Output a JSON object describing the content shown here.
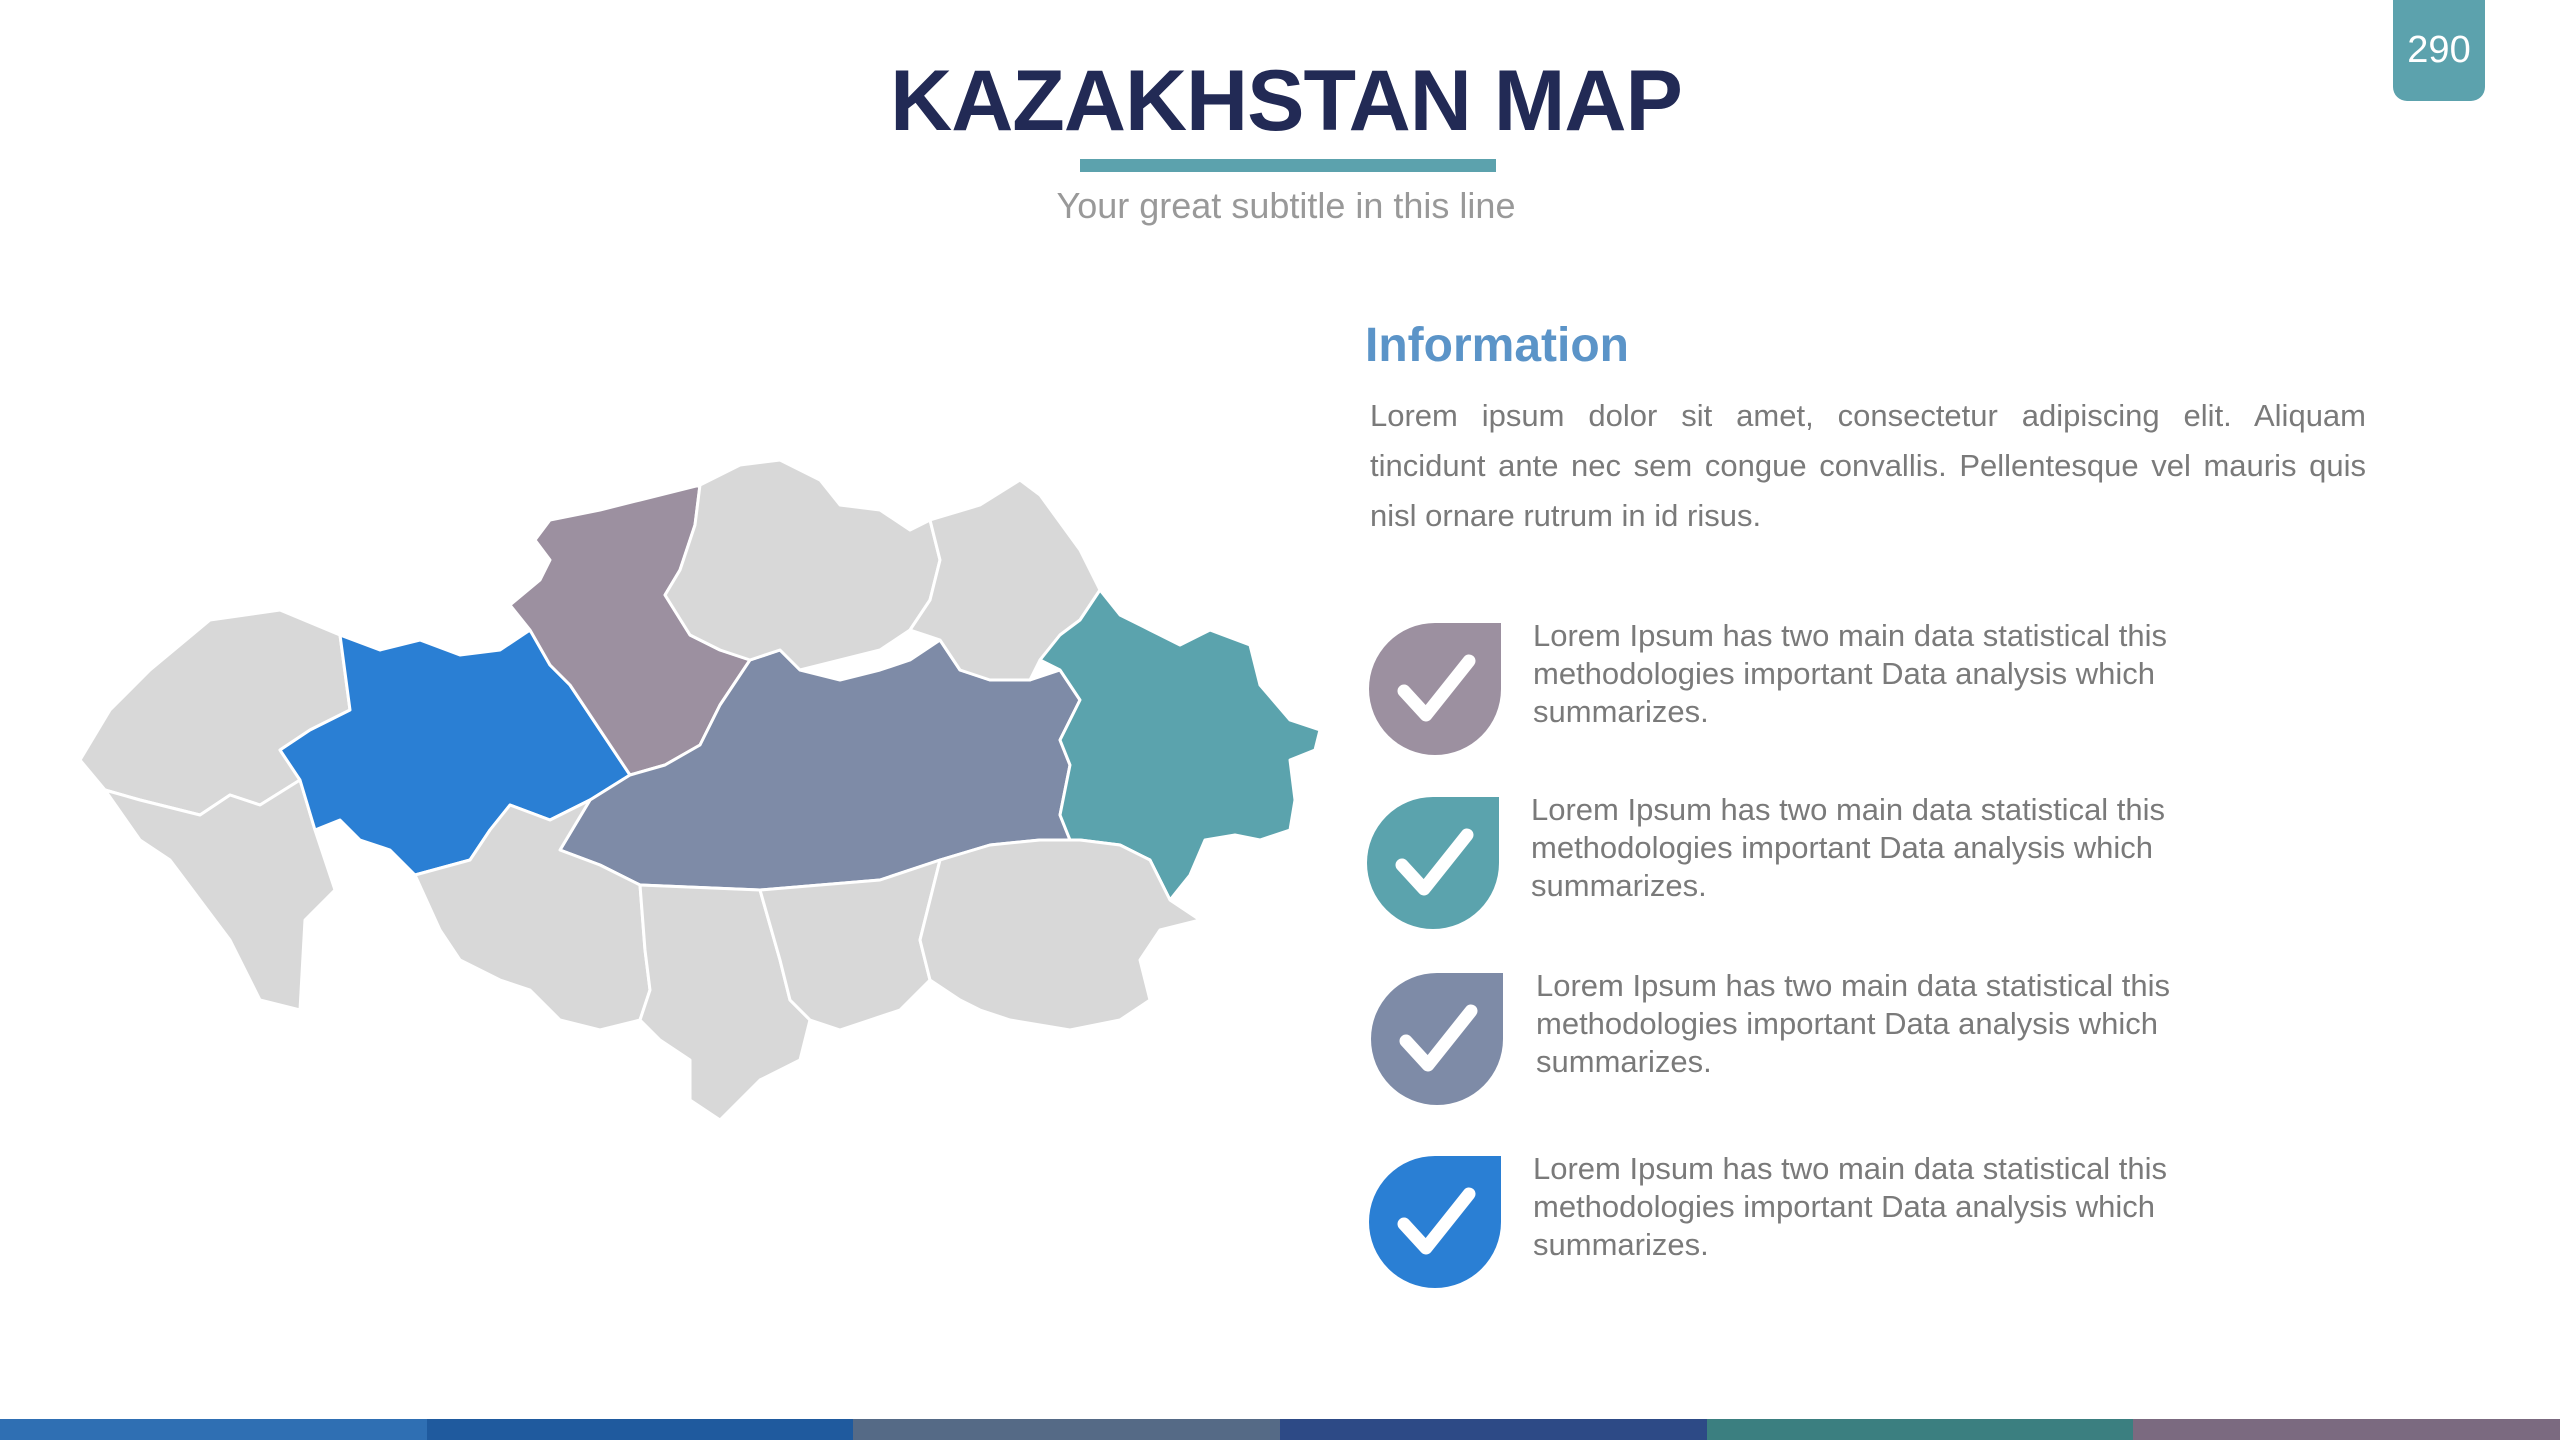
{
  "page_number": "290",
  "title": "KAZAKHSTAN MAP",
  "subtitle": "Your great subtitle in this line",
  "information": {
    "heading": "Information",
    "body": "Lorem ipsum dolor sit amet, consectetur adipiscing elit. Aliquam tincidunt ante nec sem congue convallis. Pellentesque vel mauris quis nisl ornare rutrum in id risus."
  },
  "items": [
    {
      "text": "Lorem Ipsum has two main data statistical this methodologies important Data analysis which summarizes.",
      "color": "#9c90a0",
      "icon": "check-icon"
    },
    {
      "text": "Lorem Ipsum has two main data statistical this methodologies important Data analysis which summarizes.",
      "color": "#5ba3ad",
      "icon": "check-icon"
    },
    {
      "text": "Lorem Ipsum has two main data statistical this methodologies important Data analysis which summarizes.",
      "color": "#7e8ba7",
      "icon": "check-icon"
    },
    {
      "text": "Lorem Ipsum has two main data statistical this methodologies important Data analysis which summarizes.",
      "color": "#2a7fd4",
      "icon": "check-icon"
    }
  ],
  "colors": {
    "title": "#222a55",
    "accent": "#5ca2ad",
    "region_default": "#d8d8d8",
    "region_purple": "#9c90a0",
    "region_slate": "#7e8ba7",
    "region_teal": "#5ba3ad",
    "region_blue": "#2a7fd4"
  },
  "bottom_bar_colors": [
    "#2f6fb3",
    "#1f5a9e",
    "#556a86",
    "#2d4a86",
    "#3b7f80",
    "#7b6a80"
  ]
}
